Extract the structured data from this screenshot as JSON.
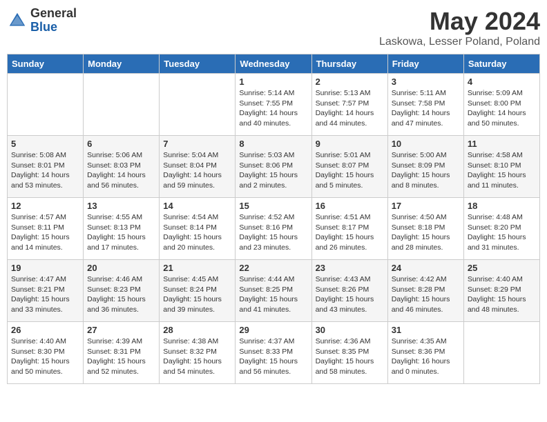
{
  "header": {
    "logo_general": "General",
    "logo_blue": "Blue",
    "month_title": "May 2024",
    "location": "Laskowa, Lesser Poland, Poland"
  },
  "weekdays": [
    "Sunday",
    "Monday",
    "Tuesday",
    "Wednesday",
    "Thursday",
    "Friday",
    "Saturday"
  ],
  "weeks": [
    [
      {
        "day": "",
        "info": ""
      },
      {
        "day": "",
        "info": ""
      },
      {
        "day": "",
        "info": ""
      },
      {
        "day": "1",
        "info": "Sunrise: 5:14 AM\nSunset: 7:55 PM\nDaylight: 14 hours\nand 40 minutes."
      },
      {
        "day": "2",
        "info": "Sunrise: 5:13 AM\nSunset: 7:57 PM\nDaylight: 14 hours\nand 44 minutes."
      },
      {
        "day": "3",
        "info": "Sunrise: 5:11 AM\nSunset: 7:58 PM\nDaylight: 14 hours\nand 47 minutes."
      },
      {
        "day": "4",
        "info": "Sunrise: 5:09 AM\nSunset: 8:00 PM\nDaylight: 14 hours\nand 50 minutes."
      }
    ],
    [
      {
        "day": "5",
        "info": "Sunrise: 5:08 AM\nSunset: 8:01 PM\nDaylight: 14 hours\nand 53 minutes."
      },
      {
        "day": "6",
        "info": "Sunrise: 5:06 AM\nSunset: 8:03 PM\nDaylight: 14 hours\nand 56 minutes."
      },
      {
        "day": "7",
        "info": "Sunrise: 5:04 AM\nSunset: 8:04 PM\nDaylight: 14 hours\nand 59 minutes."
      },
      {
        "day": "8",
        "info": "Sunrise: 5:03 AM\nSunset: 8:06 PM\nDaylight: 15 hours\nand 2 minutes."
      },
      {
        "day": "9",
        "info": "Sunrise: 5:01 AM\nSunset: 8:07 PM\nDaylight: 15 hours\nand 5 minutes."
      },
      {
        "day": "10",
        "info": "Sunrise: 5:00 AM\nSunset: 8:09 PM\nDaylight: 15 hours\nand 8 minutes."
      },
      {
        "day": "11",
        "info": "Sunrise: 4:58 AM\nSunset: 8:10 PM\nDaylight: 15 hours\nand 11 minutes."
      }
    ],
    [
      {
        "day": "12",
        "info": "Sunrise: 4:57 AM\nSunset: 8:11 PM\nDaylight: 15 hours\nand 14 minutes."
      },
      {
        "day": "13",
        "info": "Sunrise: 4:55 AM\nSunset: 8:13 PM\nDaylight: 15 hours\nand 17 minutes."
      },
      {
        "day": "14",
        "info": "Sunrise: 4:54 AM\nSunset: 8:14 PM\nDaylight: 15 hours\nand 20 minutes."
      },
      {
        "day": "15",
        "info": "Sunrise: 4:52 AM\nSunset: 8:16 PM\nDaylight: 15 hours\nand 23 minutes."
      },
      {
        "day": "16",
        "info": "Sunrise: 4:51 AM\nSunset: 8:17 PM\nDaylight: 15 hours\nand 26 minutes."
      },
      {
        "day": "17",
        "info": "Sunrise: 4:50 AM\nSunset: 8:18 PM\nDaylight: 15 hours\nand 28 minutes."
      },
      {
        "day": "18",
        "info": "Sunrise: 4:48 AM\nSunset: 8:20 PM\nDaylight: 15 hours\nand 31 minutes."
      }
    ],
    [
      {
        "day": "19",
        "info": "Sunrise: 4:47 AM\nSunset: 8:21 PM\nDaylight: 15 hours\nand 33 minutes."
      },
      {
        "day": "20",
        "info": "Sunrise: 4:46 AM\nSunset: 8:23 PM\nDaylight: 15 hours\nand 36 minutes."
      },
      {
        "day": "21",
        "info": "Sunrise: 4:45 AM\nSunset: 8:24 PM\nDaylight: 15 hours\nand 39 minutes."
      },
      {
        "day": "22",
        "info": "Sunrise: 4:44 AM\nSunset: 8:25 PM\nDaylight: 15 hours\nand 41 minutes."
      },
      {
        "day": "23",
        "info": "Sunrise: 4:43 AM\nSunset: 8:26 PM\nDaylight: 15 hours\nand 43 minutes."
      },
      {
        "day": "24",
        "info": "Sunrise: 4:42 AM\nSunset: 8:28 PM\nDaylight: 15 hours\nand 46 minutes."
      },
      {
        "day": "25",
        "info": "Sunrise: 4:40 AM\nSunset: 8:29 PM\nDaylight: 15 hours\nand 48 minutes."
      }
    ],
    [
      {
        "day": "26",
        "info": "Sunrise: 4:40 AM\nSunset: 8:30 PM\nDaylight: 15 hours\nand 50 minutes."
      },
      {
        "day": "27",
        "info": "Sunrise: 4:39 AM\nSunset: 8:31 PM\nDaylight: 15 hours\nand 52 minutes."
      },
      {
        "day": "28",
        "info": "Sunrise: 4:38 AM\nSunset: 8:32 PM\nDaylight: 15 hours\nand 54 minutes."
      },
      {
        "day": "29",
        "info": "Sunrise: 4:37 AM\nSunset: 8:33 PM\nDaylight: 15 hours\nand 56 minutes."
      },
      {
        "day": "30",
        "info": "Sunrise: 4:36 AM\nSunset: 8:35 PM\nDaylight: 15 hours\nand 58 minutes."
      },
      {
        "day": "31",
        "info": "Sunrise: 4:35 AM\nSunset: 8:36 PM\nDaylight: 16 hours\nand 0 minutes."
      },
      {
        "day": "",
        "info": ""
      }
    ]
  ]
}
